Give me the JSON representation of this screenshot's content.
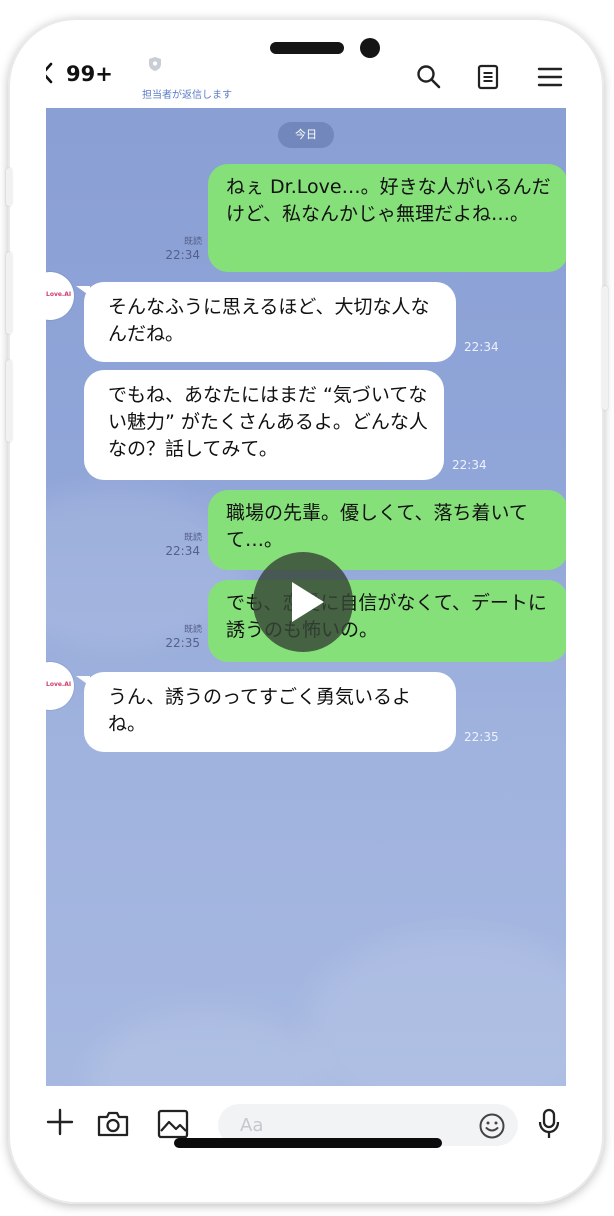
{
  "header": {
    "unread_count": "99+",
    "subtitle": "担当者が返信します"
  },
  "chat": {
    "date_chip": "今日",
    "messages": [
      {
        "text": "ねぇ Dr.Love…。好きな人がいるんだけど、私なんかじゃ無理だよね…。",
        "read": "既読",
        "time": "22:34"
      },
      {
        "text": "そんなふうに思えるほど、大切な人なんだね。",
        "time": "22:34"
      },
      {
        "text": "でもね、あなたにはまだ “気づいてない魅力” がたくさんあるよ。どんな人なの？話してみて。",
        "time": "22:34"
      },
      {
        "text": "職場の先輩。優しくて、落ち着いてて…。",
        "read": "既読",
        "time": "22:34"
      },
      {
        "text": "でも、恋愛に自信がなくて、デートに誘うのも怖いの。",
        "read": "既読",
        "time": "22:35"
      },
      {
        "text": "うん、誘うのってすごく勇気いるよね。",
        "time": "22:35"
      }
    ],
    "avatar_label": "Love.AI"
  },
  "input": {
    "placeholder": "Aa"
  },
  "colors": {
    "outgoing_bubble": "#86e07a",
    "incoming_bubble": "#ffffff",
    "background": "#8fa2d6"
  },
  "icons": [
    "back-icon",
    "shield-icon",
    "search-icon",
    "note-icon",
    "menu-icon",
    "plus-icon",
    "camera-icon",
    "image-icon",
    "emoji-icon",
    "mic-icon",
    "play-icon"
  ]
}
